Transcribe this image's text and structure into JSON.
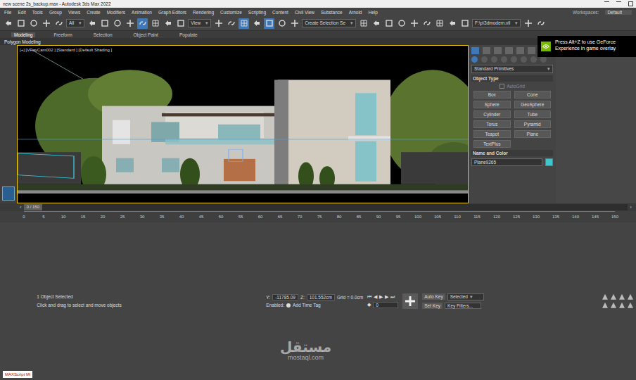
{
  "window": {
    "title": "new scene 2s_backup.max - Autodesk 3ds Max 2022"
  },
  "menu": [
    "File",
    "Edit",
    "Tools",
    "Group",
    "Views",
    "Create",
    "Modifiers",
    "Animation",
    "Graph Editors",
    "Rendering",
    "Customize",
    "Scripting",
    "Content",
    "Civil View",
    "Substance",
    "Arnold",
    "Help"
  ],
  "workspaces": {
    "label": "Workspaces:",
    "value": "Default"
  },
  "toolbar": {
    "items": [
      {
        "kind": "icon",
        "selected": false
      },
      {
        "kind": "icon",
        "selected": false
      },
      {
        "kind": "icon",
        "selected": false
      },
      {
        "kind": "icon",
        "selected": false
      },
      {
        "kind": "icon",
        "selected": false
      },
      {
        "kind": "dropdown",
        "text": "All"
      },
      {
        "kind": "icon",
        "selected": false
      },
      {
        "kind": "icon",
        "selected": false
      },
      {
        "kind": "icon",
        "selected": false
      },
      {
        "kind": "icon",
        "selected": false
      },
      {
        "kind": "icon",
        "selected": true
      },
      {
        "kind": "icon",
        "selected": false
      },
      {
        "kind": "icon",
        "selected": false
      },
      {
        "kind": "icon",
        "selected": false
      },
      {
        "kind": "dropdown",
        "text": "View"
      },
      {
        "kind": "icon",
        "selected": false
      },
      {
        "kind": "icon",
        "selected": false
      },
      {
        "kind": "icon",
        "selected": true
      },
      {
        "kind": "icon",
        "selected": false
      },
      {
        "kind": "icon",
        "selected": true
      },
      {
        "kind": "icon",
        "selected": false
      },
      {
        "kind": "icon",
        "selected": false
      },
      {
        "kind": "dropdown",
        "text": "Create Selection Se"
      },
      {
        "kind": "icon",
        "selected": false
      },
      {
        "kind": "icon",
        "selected": false
      },
      {
        "kind": "icon",
        "selected": false
      },
      {
        "kind": "icon",
        "selected": false
      },
      {
        "kind": "icon",
        "selected": false
      },
      {
        "kind": "icon",
        "selected": false
      },
      {
        "kind": "icon",
        "selected": false
      },
      {
        "kind": "icon",
        "selected": false
      },
      {
        "kind": "icon",
        "selected": false
      },
      {
        "kind": "dropdown",
        "text": "F:\\p\\3dmodern.vil"
      },
      {
        "kind": "icon",
        "selected": false
      },
      {
        "kind": "icon",
        "selected": false
      }
    ]
  },
  "ribbon": {
    "tabs": [
      {
        "label": "Modeling",
        "selected": true
      },
      {
        "label": "Freeform",
        "selected": false
      },
      {
        "label": "Selection",
        "selected": false
      },
      {
        "label": "Object Paint",
        "selected": false
      },
      {
        "label": "Populate",
        "selected": false
      }
    ],
    "panel": "Polygon Modeling"
  },
  "viewport": {
    "label": "[+] [VRayCam002 ] [Standard ] [Default Shading ]"
  },
  "command_panel": {
    "dropdown": "Standard Primitives",
    "object_type": "Object Type",
    "autogrid": {
      "label": "AutoGrid",
      "checked": false,
      "disabled": true
    },
    "buttons": [
      "Box",
      "Cone",
      "Sphere",
      "GeoSphere",
      "Cylinder",
      "Tube",
      "Torus",
      "Pyramid",
      "Teapot",
      "Plane",
      "TextPlus"
    ],
    "name_and_color": "Name and Color",
    "name": "Plane9265",
    "color": "#3ec6cc"
  },
  "overlay": {
    "text": "Press Alt+Z to use GeForce Experience in game overlay"
  },
  "timeline": {
    "frame": "0 / 150",
    "level": 0,
    "ticks": [
      "0",
      "5",
      "10",
      "15",
      "20",
      "25",
      "30",
      "35",
      "40",
      "45",
      "50",
      "55",
      "60",
      "65",
      "70",
      "75",
      "80",
      "85",
      "90",
      "95",
      "100",
      "105",
      "110",
      "115",
      "120",
      "125",
      "130",
      "135",
      "140",
      "145",
      "150"
    ]
  },
  "status": {
    "maxscript": "MAXScript Mi",
    "selected": "1 Object Selected",
    "prompt": "Click and drag to select and move objects",
    "y_label": "Y:",
    "y": "-11785.09",
    "z_label": "Z:",
    "z": "101.552cm",
    "grid": "Grid = 0.0cm",
    "enabled": "Enabled:",
    "time_tag": "Add Time Tag",
    "frame": "0",
    "auto_key": "Auto Key",
    "key_mode": "Selected",
    "set_key": "Set Key",
    "key_filters": "Key Filters..."
  },
  "watermark": {
    "arabic": "مستقل",
    "latin": "mostaql.com"
  }
}
